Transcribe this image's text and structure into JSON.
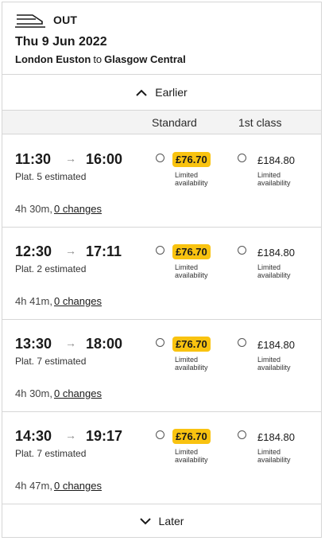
{
  "header": {
    "direction_label": "OUT",
    "date": "Thu 9 Jun 2022",
    "origin": "London Euston",
    "connector": "to",
    "destination": "Glasgow Central",
    "icon": "train-icon"
  },
  "nav": {
    "earlier_label": "Earlier",
    "later_label": "Later"
  },
  "columns": {
    "standard": "Standard",
    "first": "1st class"
  },
  "journeys": [
    {
      "depart": "11:30",
      "arrive": "16:00",
      "platform": "Plat. 5 estimated",
      "duration": "4h 30m,",
      "changes": "0 changes",
      "standard_price": "£76.70",
      "standard_note_1": "Limited",
      "standard_note_2": "availability",
      "first_price": "£184.80",
      "first_note_1": "Limited",
      "first_note_2": "availability"
    },
    {
      "depart": "12:30",
      "arrive": "17:11",
      "platform": "Plat. 2 estimated",
      "duration": "4h 41m,",
      "changes": "0 changes",
      "standard_price": "£76.70",
      "standard_note_1": "Limited",
      "standard_note_2": "availability",
      "first_price": "£184.80",
      "first_note_1": "Limited",
      "first_note_2": "availability"
    },
    {
      "depart": "13:30",
      "arrive": "18:00",
      "platform": "Plat. 7 estimated",
      "duration": "4h 30m,",
      "changes": "0 changes",
      "standard_price": "£76.70",
      "standard_note_1": "Limited",
      "standard_note_2": "availability",
      "first_price": "£184.80",
      "first_note_1": "Limited",
      "first_note_2": "availability"
    },
    {
      "depart": "14:30",
      "arrive": "19:17",
      "platform": "Plat. 7 estimated",
      "duration": "4h 47m,",
      "changes": "0 changes",
      "standard_price": "£76.70",
      "standard_note_1": "Limited",
      "standard_note_2": "availability",
      "first_price": "£184.80",
      "first_note_1": "Limited",
      "first_note_2": "availability"
    }
  ],
  "colors": {
    "price_highlight": "#f9c310",
    "border": "#d6d6d6",
    "column_header_bg": "#f3f3f3"
  }
}
